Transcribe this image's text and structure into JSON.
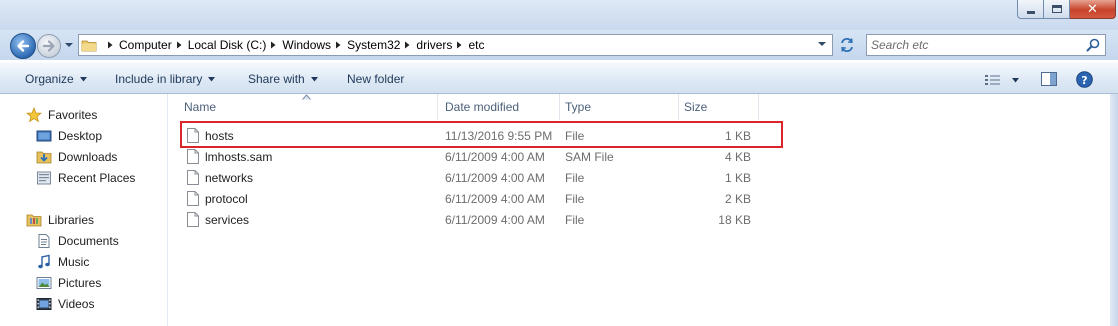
{
  "window": {
    "controls": {
      "minimize_icon": "minimize-icon",
      "maximize_icon": "maximize-icon",
      "close_glyph": "✕"
    }
  },
  "address_bar": {
    "breadcrumbs": [
      "Computer",
      "Local Disk (C:)",
      "Windows",
      "System32",
      "drivers",
      "etc"
    ]
  },
  "search": {
    "placeholder": "Search etc"
  },
  "toolbar": {
    "organize_label": "Organize",
    "include_label": "Include in library",
    "share_label": "Share with",
    "new_folder_label": "New folder"
  },
  "nav": {
    "favorites_label": "Favorites",
    "favorites": [
      {
        "label": "Desktop",
        "icon": "desktop-icon"
      },
      {
        "label": "Downloads",
        "icon": "downloads-icon"
      },
      {
        "label": "Recent Places",
        "icon": "recent-places-icon"
      }
    ],
    "libraries_label": "Libraries",
    "libraries": [
      {
        "label": "Documents",
        "icon": "documents-icon"
      },
      {
        "label": "Music",
        "icon": "music-icon"
      },
      {
        "label": "Pictures",
        "icon": "pictures-icon"
      },
      {
        "label": "Videos",
        "icon": "videos-icon"
      }
    ]
  },
  "columns": {
    "name": "Name",
    "date": "Date modified",
    "type": "Type",
    "size": "Size"
  },
  "files": [
    {
      "name": "hosts",
      "date": "11/13/2016 9:55 PM",
      "type": "File",
      "size": "1 KB",
      "highlighted": true
    },
    {
      "name": "lmhosts.sam",
      "date": "6/11/2009 4:00 AM",
      "type": "SAM File",
      "size": "4 KB"
    },
    {
      "name": "networks",
      "date": "6/11/2009 4:00 AM",
      "type": "File",
      "size": "1 KB"
    },
    {
      "name": "protocol",
      "date": "6/11/2009 4:00 AM",
      "type": "File",
      "size": "2 KB"
    },
    {
      "name": "services",
      "date": "6/11/2009 4:00 AM",
      "type": "File",
      "size": "18 KB"
    }
  ],
  "colors": {
    "highlight_border": "#d9252b",
    "command_text": "#1e395b",
    "meta_text": "#6d6d6d"
  }
}
